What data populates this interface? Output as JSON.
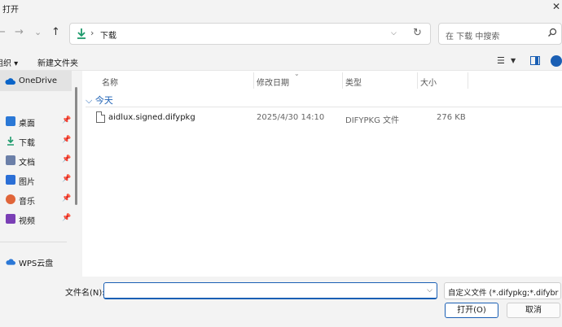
{
  "window": {
    "title": "打开"
  },
  "nav": {
    "back": "←",
    "forward": "→",
    "recent": "⌄",
    "up": "↑"
  },
  "address": {
    "crumb": "下载"
  },
  "search": {
    "placeholder": "在 下载 中搜索"
  },
  "toolbar": {
    "organize": "组织 ▾",
    "new_folder": "新建文件夹"
  },
  "sidebar": {
    "onedrive": "OneDrive",
    "items": [
      {
        "label": "桌面",
        "icon": "desktop-icon",
        "color": "#2b78d6"
      },
      {
        "label": "下载",
        "icon": "download-icon",
        "color": "#1d9a6c"
      },
      {
        "label": "文档",
        "icon": "documents-icon",
        "color": "#6b7fa8"
      },
      {
        "label": "图片",
        "icon": "pictures-icon",
        "color": "#2b6fd6"
      },
      {
        "label": "音乐",
        "icon": "music-icon",
        "color": "#e0653a"
      },
      {
        "label": "视频",
        "icon": "videos-icon",
        "color": "#7a3fb5"
      }
    ],
    "wps": "WPS云盘"
  },
  "columns": {
    "name": "名称",
    "modified": "修改日期",
    "type": "类型",
    "size": "大小"
  },
  "group": {
    "label": "今天"
  },
  "files": [
    {
      "name": "aidlux.signed.difypkg",
      "modified": "2025/4/30 14:10",
      "type": "DIFYPKG 文件",
      "size": "276 KB"
    }
  ],
  "footer": {
    "filename_label": "文件名(N):",
    "filename_value": "",
    "filter": "自定义文件 (*.difypkg;*.difybr",
    "open": "打开(O)",
    "cancel": "取消"
  },
  "colors": {
    "accent": "#1a5fb4",
    "selected_bg": "#e3e3e3"
  }
}
